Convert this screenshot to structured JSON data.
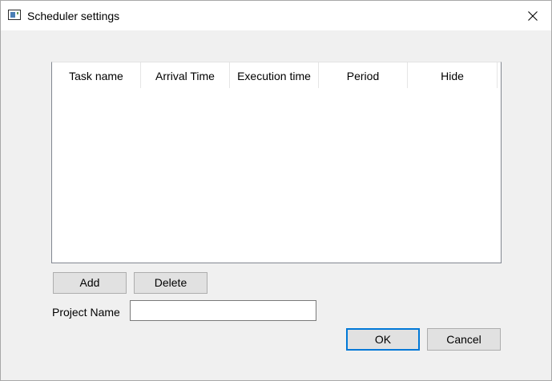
{
  "window": {
    "title": "Scheduler settings",
    "icon": "app-window-icon",
    "close_icon": "close-icon"
  },
  "table": {
    "columns": [
      "Task name",
      "Arrival Time",
      "Execution time",
      "Period",
      "Hide"
    ],
    "rows": []
  },
  "buttons": {
    "add": "Add",
    "delete": "Delete",
    "ok": "OK",
    "cancel": "Cancel"
  },
  "project": {
    "label": "Project Name",
    "value": "",
    "placeholder": ""
  },
  "colors": {
    "accent": "#0078d7",
    "window_bg": "#f0f0f0",
    "button_bg": "#e1e1e1"
  }
}
